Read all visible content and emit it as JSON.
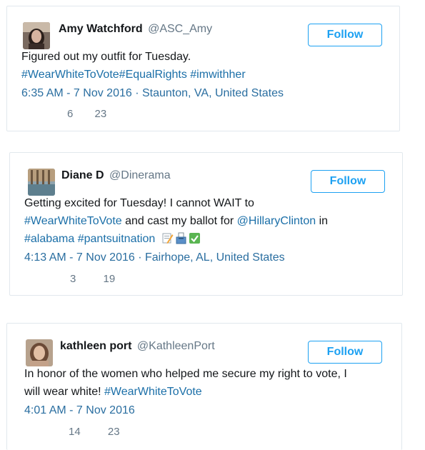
{
  "tweets": [
    {
      "display_name": "Amy Watchford",
      "handle": "@ASC_Amy",
      "follow_label": "Follow",
      "text_lines": [
        [
          {
            "t": "Figured out my outfit for Tuesday.",
            "link": false
          }
        ],
        [
          {
            "t": "#WearWhiteToVote#EqualRights #imwithher",
            "link": true
          }
        ]
      ],
      "timestamp": "6:35 AM - 7 Nov 2016 · Staunton, VA, United States",
      "retweets": "6",
      "likes": "23"
    },
    {
      "display_name": "Diane D",
      "handle": "@Dinerama",
      "follow_label": "Follow",
      "text_lines": [
        [
          {
            "t": "Getting excited for Tuesday! I cannot WAIT to",
            "link": false
          }
        ],
        [
          {
            "t": "#WearWhiteToVote",
            "link": true
          },
          {
            "t": " and cast my ballot for ",
            "link": false
          },
          {
            "t": "@HillaryClinton",
            "link": true
          },
          {
            "t": " in",
            "link": false
          }
        ],
        [
          {
            "t": "#alabama",
            "link": true
          },
          {
            "t": " ",
            "link": false
          },
          {
            "t": "#pantsuitnation",
            "link": true
          }
        ]
      ],
      "emoji_icons": [
        "memo-pencil-icon",
        "ballot-box-icon",
        "check-mark-icon"
      ],
      "timestamp": "4:13 AM - 7 Nov 2016 · Fairhope, AL, United States",
      "retweets": "3",
      "likes": "19"
    },
    {
      "display_name": "kathleen port",
      "handle": "@KathleenPort",
      "follow_label": "Follow",
      "text_lines": [
        [
          {
            "t": "In honor of the women who helped me secure my right to vote, I",
            "link": false
          }
        ],
        [
          {
            "t": "will wear white! ",
            "link": false
          },
          {
            "t": "#WearWhiteToVote",
            "link": true
          }
        ]
      ],
      "timestamp": "4:01 AM - 7 Nov 2016",
      "retweets": "14",
      "likes": "23"
    }
  ],
  "colors": {
    "link": "#1b6fa8",
    "follow_border": "#1da1f2",
    "muted": "#657786",
    "card_border": "#e1e8ed"
  }
}
